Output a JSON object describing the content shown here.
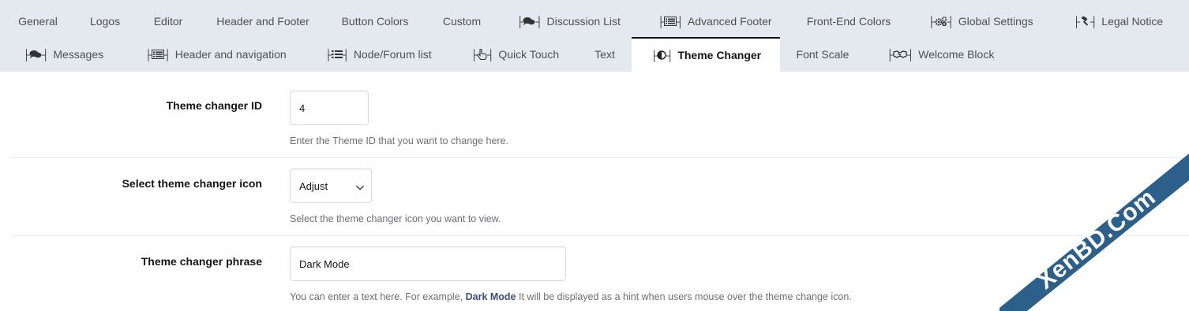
{
  "tabs": {
    "row1": [
      {
        "label": "General",
        "icon": null
      },
      {
        "label": "Logos",
        "icon": null
      },
      {
        "label": "Editor",
        "icon": null
      },
      {
        "label": "Header and Footer",
        "icon": null
      },
      {
        "label": "Button Colors",
        "icon": null
      },
      {
        "label": "Custom",
        "icon": null
      },
      {
        "label": "Discussion List",
        "icon": "comments-icon"
      },
      {
        "label": "Advanced Footer",
        "icon": "list-box-icon"
      },
      {
        "label": "Front-End Colors",
        "icon": null
      },
      {
        "label": "Global Settings",
        "icon": "cogs-icon"
      },
      {
        "label": "Legal Notice",
        "icon": "gavel-icon"
      }
    ],
    "row2": [
      {
        "label": "Messages",
        "icon": "comments-icon"
      },
      {
        "label": "Header and navigation",
        "icon": "list-box-icon"
      },
      {
        "label": "Node/Forum list",
        "icon": "list-icon"
      },
      {
        "label": "Quick Touch",
        "icon": "hand-pointer-icon"
      },
      {
        "label": "Text",
        "icon": null
      },
      {
        "label": "Theme Changer",
        "icon": "adjust-icon",
        "active": true
      },
      {
        "label": "Font Scale",
        "icon": null
      },
      {
        "label": "Welcome Block",
        "icon": "handshake-icon"
      }
    ]
  },
  "form": {
    "theme_id": {
      "label": "Theme changer ID",
      "value": "4",
      "hint": "Enter the Theme ID that you want to change here."
    },
    "icon_select": {
      "label": "Select theme changer icon",
      "value": "Adjust",
      "hint": "Select the theme changer icon you want to view."
    },
    "phrase": {
      "label": "Theme changer phrase",
      "value": "Dark Mode",
      "hint_before": "You can enter a text here. For example,",
      "hint_bold": "Dark Mode",
      "hint_after": "It will be displayed as a hint when users mouse over the theme change icon."
    }
  },
  "watermark": {
    "text": "XenBD.Com"
  },
  "colors": {
    "tabbar_bg": "#e4e8ef",
    "hint_bold": "#3d4f73",
    "watermark_bg": "#2d5f8b"
  }
}
